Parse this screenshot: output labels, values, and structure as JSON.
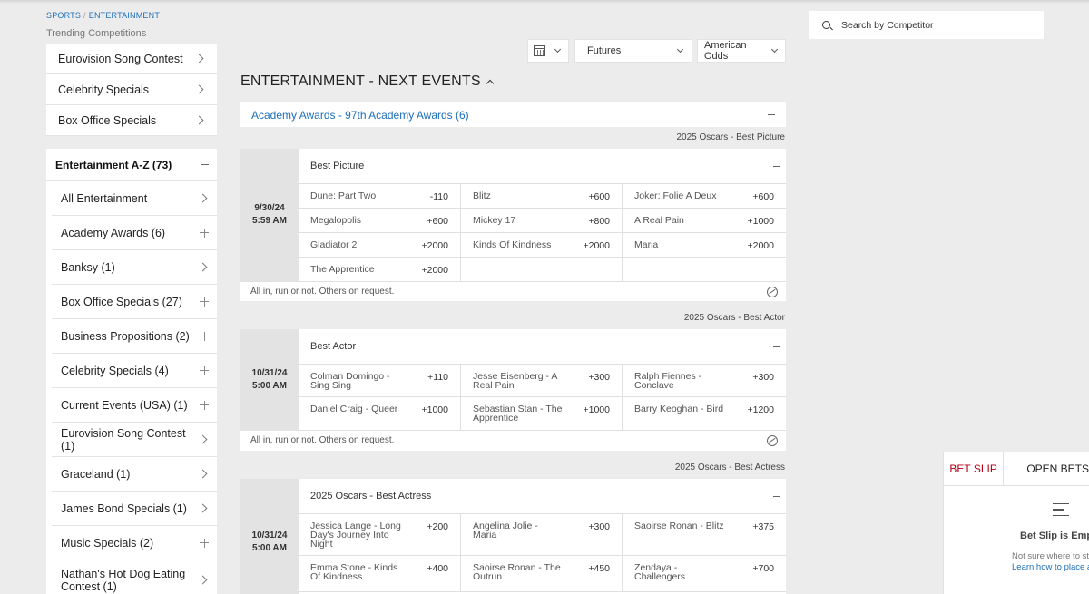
{
  "breadcrumb": {
    "sports": "SPORTS",
    "sep": "/",
    "entertainment": "ENTERTAINMENT"
  },
  "trending": {
    "label": "Trending Competitions",
    "items": [
      "Eurovision Song Contest",
      "Celebrity Specials",
      "Box Office Specials"
    ]
  },
  "az": {
    "title": "Entertainment A-Z (73)",
    "items": [
      {
        "label": "All Entertainment",
        "icon": "chevron-right"
      },
      {
        "label": "Academy Awards (6)",
        "icon": "plus"
      },
      {
        "label": "Banksy (1)",
        "icon": "chevron-right"
      },
      {
        "label": "Box Office Specials (27)",
        "icon": "plus"
      },
      {
        "label": "Business Propositions (2)",
        "icon": "plus"
      },
      {
        "label": "Celebrity Specials (4)",
        "icon": "plus"
      },
      {
        "label": "Current Events (USA) (1)",
        "icon": "plus"
      },
      {
        "label": "Eurovision Song Contest (1)",
        "icon": "chevron-right"
      },
      {
        "label": "Graceland (1)",
        "icon": "chevron-right"
      },
      {
        "label": "James Bond Specials (1)",
        "icon": "chevron-right"
      },
      {
        "label": "Music Specials (2)",
        "icon": "plus"
      },
      {
        "label": "Nathan's Hot Dog Eating Contest (1)",
        "icon": "chevron-right"
      }
    ]
  },
  "controls": {
    "market_select": "Futures",
    "odds_select": "American Odds"
  },
  "main": {
    "title": "ENTERTAINMENT - NEXT EVENTS",
    "competition": "Academy Awards - 97th Academy Awards (6)"
  },
  "events": [
    {
      "section_label": "2025 Oscars - Best Picture",
      "date": "9/30/24",
      "time": "5:59 AM",
      "market": "Best Picture",
      "selections": [
        {
          "name": "Dune: Part Two",
          "odds": "-110"
        },
        {
          "name": "Blitz",
          "odds": "+600"
        },
        {
          "name": "Joker: Folie A Deux",
          "odds": "+600"
        },
        {
          "name": "Megalopolis",
          "odds": "+600"
        },
        {
          "name": "Mickey 17",
          "odds": "+800"
        },
        {
          "name": "A Real Pain",
          "odds": "+1000"
        },
        {
          "name": "Gladiator 2",
          "odds": "+2000"
        },
        {
          "name": "Kinds Of Kindness",
          "odds": "+2000"
        },
        {
          "name": "Maria",
          "odds": "+2000"
        },
        {
          "name": "The Apprentice",
          "odds": "+2000"
        },
        {
          "name": "",
          "odds": ""
        },
        {
          "name": "",
          "odds": ""
        }
      ],
      "footer": "All in, run or not. Others on request."
    },
    {
      "section_label": "2025 Oscars - Best Actor",
      "date": "10/31/24",
      "time": "5:00 AM",
      "market": "Best Actor",
      "selections": [
        {
          "name": "Colman Domingo - Sing Sing",
          "odds": "+110"
        },
        {
          "name": "Jesse Eisenberg - A Real Pain",
          "odds": "+300"
        },
        {
          "name": "Ralph Fiennes - Conclave",
          "odds": "+300"
        },
        {
          "name": "Daniel Craig - Queer",
          "odds": "+1000"
        },
        {
          "name": "Sebastian Stan - The Apprentice",
          "odds": "+1000"
        },
        {
          "name": "Barry Keoghan - Bird",
          "odds": "+1200"
        }
      ],
      "footer": "All in, run or not. Others on request."
    },
    {
      "section_label": "2025 Oscars - Best Actress",
      "date": "10/31/24",
      "time": "5:00 AM",
      "market": "2025 Oscars - Best Actress",
      "selections": [
        {
          "name": "Jessica Lange - Long Day's Journey Into Night",
          "odds": "+200"
        },
        {
          "name": "Angelina Jolie - Maria",
          "odds": "+300"
        },
        {
          "name": "Saoirse Ronan - Blitz",
          "odds": "+375"
        },
        {
          "name": "Emma Stone - Kinds Of Kindness",
          "odds": "+400"
        },
        {
          "name": "Saoirse Ronan - The Outrun",
          "odds": "+450"
        },
        {
          "name": "Zendaya - Challengers",
          "odds": "+700"
        }
      ]
    }
  ],
  "search": {
    "placeholder": "Search by Competitor"
  },
  "betslip": {
    "tab_active": "BET SLIP",
    "tab_other": "OPEN BETS",
    "empty_title": "Bet Slip is Empty",
    "note": "Not sure where to start?",
    "link": "Learn how to place a bet"
  }
}
